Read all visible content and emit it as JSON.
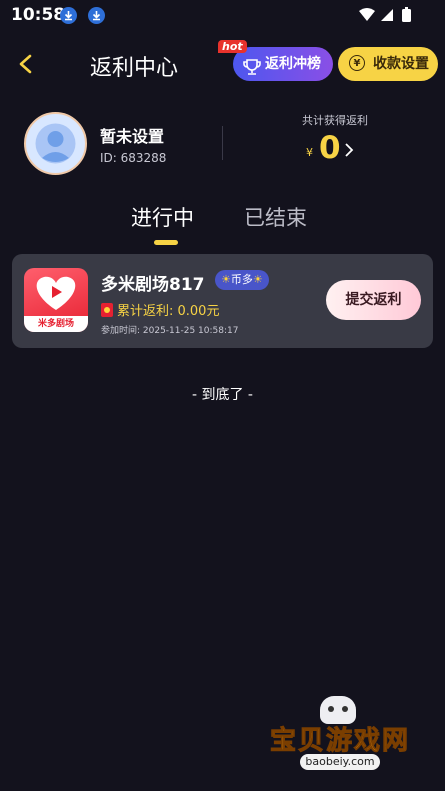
{
  "status_bar": {
    "time": "10:58"
  },
  "header": {
    "title": "返利中心",
    "rank_button": "返利冲榜",
    "hot_badge": "hot",
    "payment_button": "收款设置",
    "payment_icon": "¥"
  },
  "profile": {
    "username": "暂未设置",
    "id": "ID: 683288",
    "total_label": "共计获得返利",
    "currency": "¥",
    "total_value": "0"
  },
  "tabs": [
    {
      "label": "进行中",
      "active": true
    },
    {
      "label": "已结束",
      "active": false
    }
  ],
  "card": {
    "logo_text": "米多剧场",
    "app_name": "多米剧场817",
    "badge_text": "币多",
    "rebate": "累计返利: 0.00元",
    "joined": "参加时间: 2025-11-25 10:58:17",
    "submit_button": "提交返利"
  },
  "end_text": "- 到底了 -",
  "watermark": {
    "text": "宝贝游戏网",
    "url": "baobeiy.com"
  },
  "colors": {
    "accent": "#f7d345",
    "background": "#13121d",
    "card": "#393a45"
  }
}
